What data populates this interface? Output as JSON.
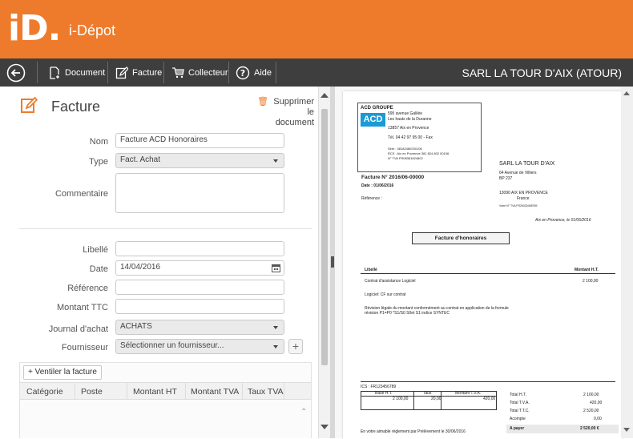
{
  "app": {
    "logo": "iD.",
    "title": "i-Dépot"
  },
  "toolbar": {
    "document": "Document",
    "facture": "Facture",
    "collecteur": "Collecteur",
    "aide": "Aide",
    "company": "SARL LA TOUR D'AIX (ATOUR)"
  },
  "form": {
    "title": "Facture",
    "delete_line1": "Supprimer le",
    "delete_line2": "document",
    "nom_label": "Nom",
    "nom_value": "Facture ACD Honoraires",
    "type_label": "Type",
    "type_value": "Fact. Achat",
    "commentaire_label": "Commentaire",
    "libelle_label": "Libellé",
    "date_label": "Date",
    "date_value": "14/04/2016",
    "reference_label": "Référence",
    "montant_label": "Montant TTC",
    "journal_label": "Journal d'achat",
    "journal_value": "ACHATS",
    "fournisseur_label": "Fournisseur",
    "fournisseur_value": "Sélectionner un fournisseur...",
    "ventiler_label": "Ventiler la facture",
    "columns": [
      "Catégorie",
      "Poste",
      "Montant HT",
      "Montant TVA",
      "Taux TVA"
    ]
  },
  "invoice": {
    "sender": {
      "name": "ACD GROUPE",
      "addr1": "595 avenue Galilée",
      "addr2": "Les hauts de la Duranne",
      "addr3": "13857 Aix en Provence",
      "tel": "Tél.  04 42 97 95 00  - Fax",
      "siret": "Siret : 38182480200106",
      "rcs": "RCS : Aix en Provence 381 824 802 00106",
      "tva": "N° TVA FR08381824802",
      "logo": "ACD"
    },
    "number": "Facture N° 2016/06-00000",
    "date": "Date : 01/06/2016",
    "reference": "Référence :",
    "recipient": {
      "name": "SARL LA TOUR D'AIX",
      "addr1": "64 Avenue de Villiers",
      "addr2": "BP 237",
      "addr3": "13090 AIX EN PROVENCE",
      "country": "France",
      "tva": "Votre N° TVA FR26320498789"
    },
    "place_date": "Aix en Provence, le 01/06/2016",
    "doc_title": "Facture d'honoraires",
    "col_libelle": "Libellé",
    "col_montant": "Montant H.T.",
    "line1": "Contrat d'assistance Logiciel",
    "line1_amount": "2 100,00",
    "line2": "Logiciel: CF sur contrat",
    "line3a": "Révision légale du montant conformément au contrat en application de la formule",
    "line3b": "révision P1=P0 *S1/S0         S0et S1 indice SYNTEC",
    "ics": "ICS : FR123456789",
    "t_base": "Base H.T.",
    "t_taux": "Taux",
    "t_mtva": "Montant T.V.A.",
    "v_base": "2 100,00",
    "v_taux": "20,00",
    "v_mtva": "420,00",
    "tot_ht_l": "Total H.T.",
    "tot_ht_v": "2 100,00",
    "tot_tva_l": "Total T.V.A.",
    "tot_tva_v": "420,00",
    "tot_ttc_l": "Total T.T.C.",
    "tot_ttc_v": "2 520,00",
    "acompte_l": "Acompte",
    "acompte_v": "0,00",
    "payer_l": "A payer",
    "payer_v": "2 520,00  €",
    "footer": "En votre aimable règlement par Prélèvement le 30/06/2016"
  },
  "colors": {
    "accent": "#ee7b2c",
    "toolbar": "#3e3e3e"
  }
}
